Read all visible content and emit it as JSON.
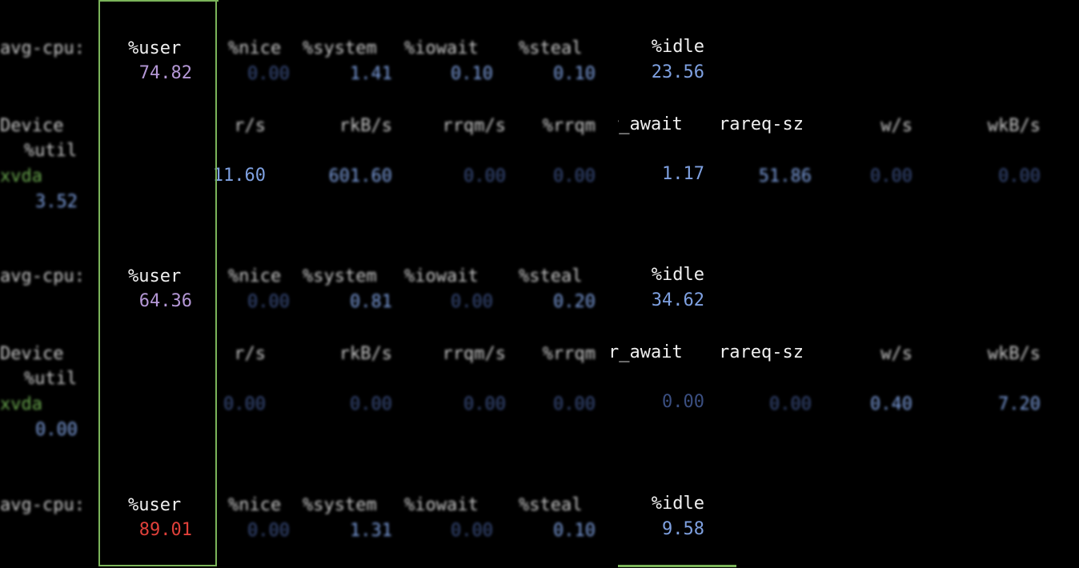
{
  "cpu_labels": {
    "avg_cpu": "avg-cpu:",
    "user": "%user",
    "nice": "%nice",
    "system": "%system",
    "iowait": "%iowait",
    "steal": "%steal",
    "idle": "%idle"
  },
  "device_labels": {
    "device": "Device",
    "util": "%util",
    "rs": "r/s",
    "rkbs": "rkB/s",
    "rrqms": "rrqm/s",
    "rrqm_pct": "%rrqm",
    "r_await": "r_await",
    "rareq_sz": "rareq-sz",
    "ws": "w/s",
    "wkbs": "wkB/s"
  },
  "blocks": [
    {
      "cpu": {
        "user": "74.82",
        "nice": "0.00",
        "system": "1.41",
        "iowait": "0.10",
        "steal": "0.10",
        "idle": "23.56"
      },
      "device": {
        "name": "xvda",
        "rs": "11.60",
        "rkbs": "601.60",
        "rrqms": "0.00",
        "rrqm_pct": "0.00",
        "r_await": "1.17",
        "rareq_sz": "51.86",
        "ws": "0.00",
        "wkbs": "0.00",
        "util": "3.52"
      }
    },
    {
      "cpu": {
        "user": "64.36",
        "nice": "0.00",
        "system": "0.81",
        "iowait": "0.00",
        "steal": "0.20",
        "idle": "34.62"
      },
      "device": {
        "name": "xvda",
        "rs": "0.00",
        "rkbs": "0.00",
        "rrqms": "0.00",
        "rrqm_pct": "0.00",
        "r_await": "0.00",
        "rareq_sz": "0.00",
        "ws": "0.40",
        "wkbs": "7.20",
        "util": "0.00"
      }
    },
    {
      "cpu": {
        "user": "89.01",
        "nice": "0.00",
        "system": "1.31",
        "iowait": "0.00",
        "steal": "0.10",
        "idle": "9.58"
      }
    }
  ],
  "colors": {
    "focus_border": "#7bb45a",
    "user_normal": "#b497d6",
    "user_high": "#e0403a",
    "value": "#7ea0e0"
  }
}
